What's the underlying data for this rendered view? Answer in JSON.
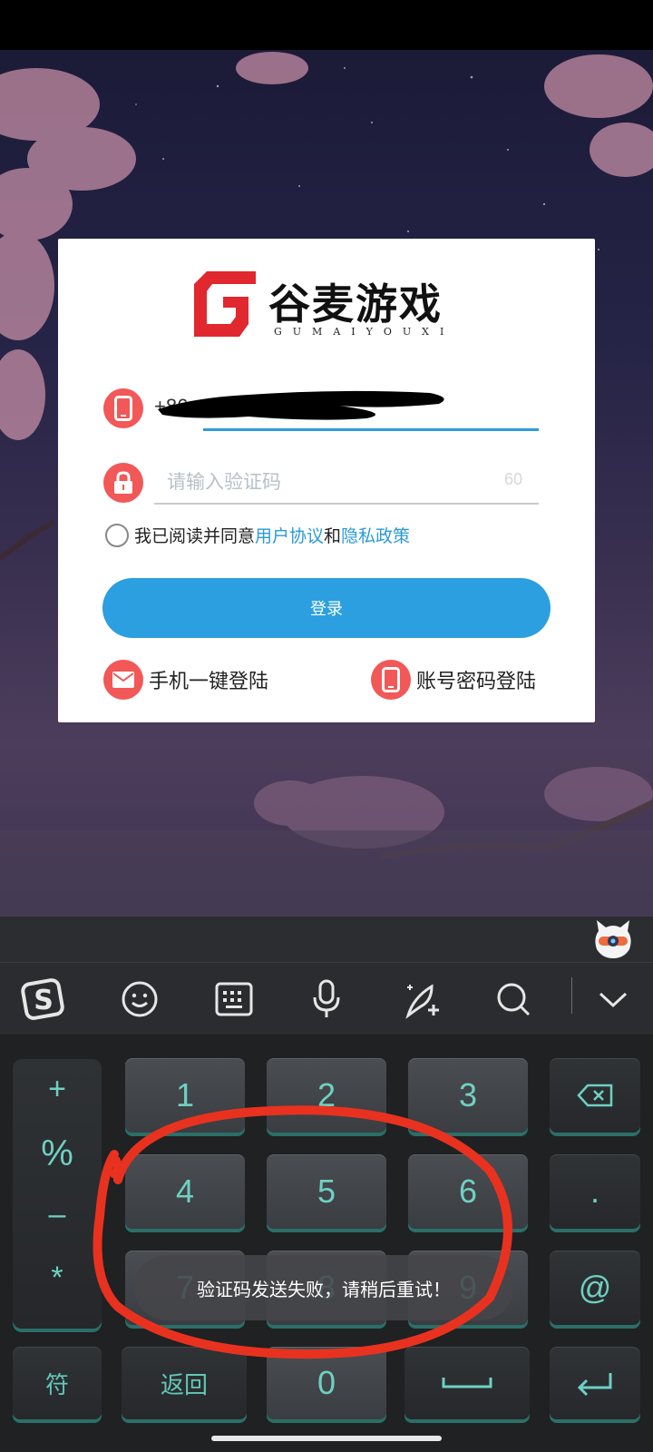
{
  "login_card": {
    "brand_cn": "谷麦游戏",
    "brand_en": "GUMAIYOUXI",
    "phone_prefix": "+86",
    "code_placeholder": "请输入验证码",
    "countdown": "60",
    "agree_prefix": "我已阅读并同意",
    "user_agreement": "用户协议",
    "agree_and": "和",
    "privacy_policy": "隐私政策",
    "login_button": "登录",
    "one_tap_login": "手机一键登陆",
    "password_login": "账号密码登陆"
  },
  "keyboard": {
    "side_symbols": [
      "+",
      "%",
      "–",
      "*"
    ],
    "digits_row1": [
      "1",
      "2",
      "3"
    ],
    "digits_row2": [
      "4",
      "5",
      "6"
    ],
    "digits_row3": [
      "7",
      "8",
      "9"
    ],
    "bottom_left": "符",
    "bottom_return": "返回",
    "bottom_zero": "0",
    "dot": ".",
    "at": "@"
  },
  "toast": {
    "message": "验证码发送失败，请稍后重试！"
  },
  "colors": {
    "accent_blue": "#2b9fe0",
    "icon_red": "#f15857",
    "keyboard_teal": "#6fd0c2",
    "annotation_red": "#e8321f"
  }
}
